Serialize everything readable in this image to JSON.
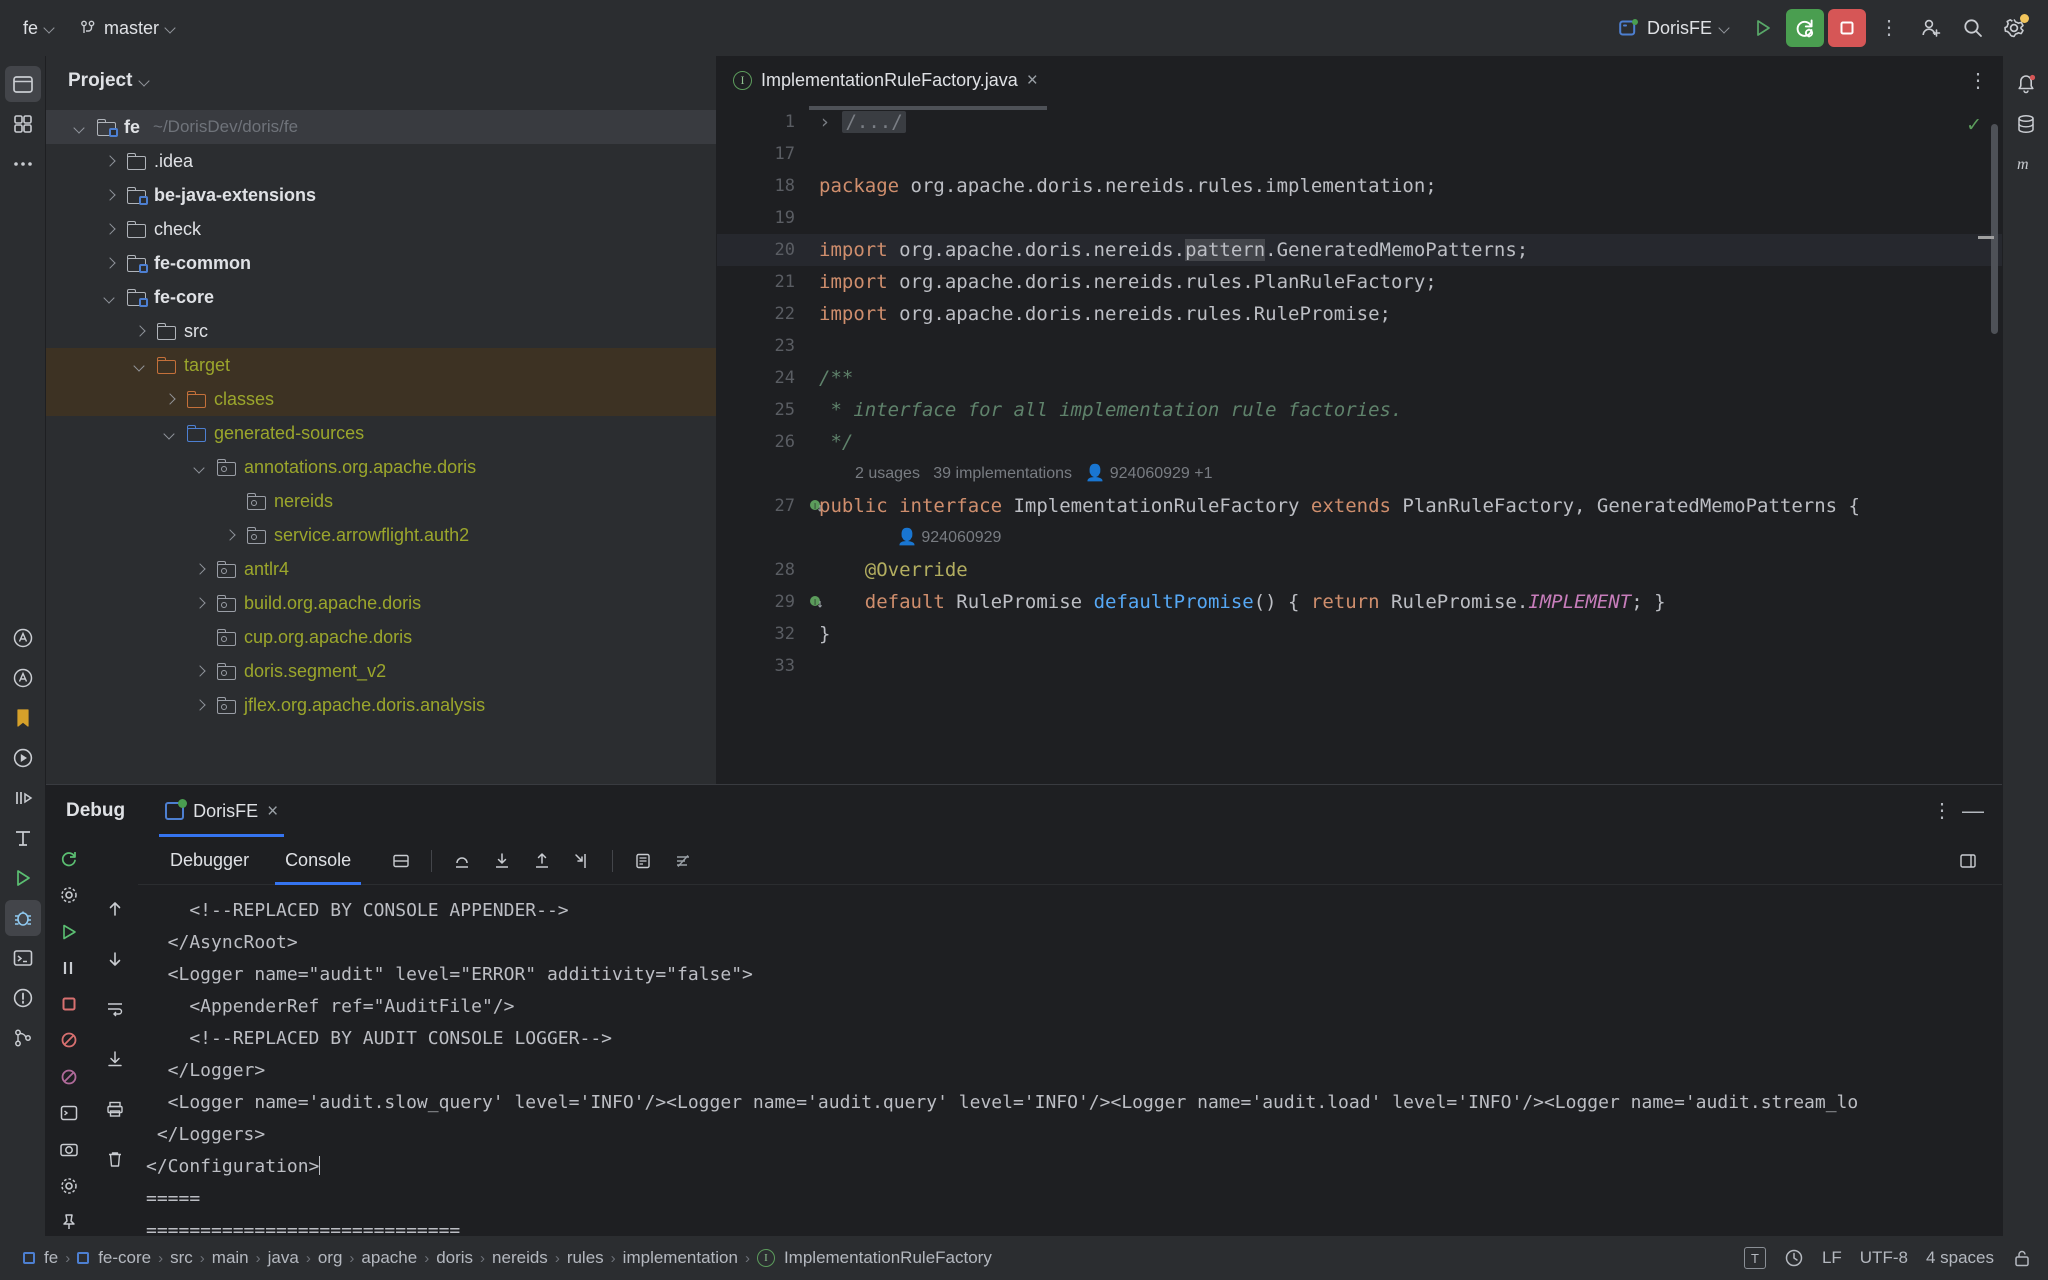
{
  "topbar": {
    "project_name": "fe",
    "branch": "master",
    "branch_icon": "git-branch-icon",
    "run_config": "DorisFE",
    "run_button": "run-icon",
    "rerun_debug_button": "rerun-debug-icon",
    "stop_button": "stop-icon",
    "more_button": "more-vertical-icon",
    "add_user_button": "add-user-icon",
    "search_button": "search-icon",
    "settings_button": "settings-gear-icon",
    "accent_green": "#4a9e50",
    "accent_red": "#d65656",
    "badge_yellow": "#f2c55c"
  },
  "project_panel": {
    "title": "Project",
    "tree": [
      {
        "label": "fe",
        "path": "~/DorisDev/doris/fe",
        "indent": 0,
        "arrow": "open",
        "icon": "module-folder-icon",
        "bold": true,
        "selected": true
      },
      {
        "label": ".idea",
        "path": "",
        "indent": 1,
        "arrow": "closed",
        "icon": "folder-icon",
        "bold": false,
        "selected": false
      },
      {
        "label": "be-java-extensions",
        "path": "",
        "indent": 1,
        "arrow": "closed",
        "icon": "module-folder-icon",
        "bold": true,
        "selected": false
      },
      {
        "label": "check",
        "path": "",
        "indent": 1,
        "arrow": "closed",
        "icon": "folder-icon",
        "bold": false,
        "selected": false
      },
      {
        "label": "fe-common",
        "path": "",
        "indent": 1,
        "arrow": "closed",
        "icon": "module-folder-icon",
        "bold": true,
        "selected": false
      },
      {
        "label": "fe-core",
        "path": "",
        "indent": 1,
        "arrow": "open",
        "icon": "module-folder-icon",
        "bold": true,
        "selected": false
      },
      {
        "label": "src",
        "path": "",
        "indent": 2,
        "arrow": "closed",
        "icon": "folder-icon",
        "bold": false,
        "selected": false
      },
      {
        "label": "target",
        "path": "",
        "indent": 2,
        "arrow": "open",
        "icon": "excluded-folder-icon",
        "bold": false,
        "selected": false,
        "highlight": true,
        "color": "yellow"
      },
      {
        "label": "classes",
        "path": "",
        "indent": 3,
        "arrow": "closed",
        "icon": "excluded-folder-icon",
        "bold": false,
        "selected": false,
        "highlight": true,
        "color": "yellow"
      },
      {
        "label": "generated-sources",
        "path": "",
        "indent": 3,
        "arrow": "open",
        "icon": "source-folder-icon",
        "bold": false,
        "selected": false,
        "color": "yellow"
      },
      {
        "label": "annotations.org.apache.doris",
        "path": "",
        "indent": 4,
        "arrow": "open",
        "icon": "package-folder-icon",
        "bold": false,
        "selected": false,
        "color": "yellow"
      },
      {
        "label": "nereids",
        "path": "",
        "indent": 5,
        "arrow": "none",
        "icon": "package-folder-icon",
        "bold": false,
        "selected": false,
        "color": "yellow"
      },
      {
        "label": "service.arrowflight.auth2",
        "path": "",
        "indent": 5,
        "arrow": "closed",
        "icon": "package-folder-icon",
        "bold": false,
        "selected": false,
        "color": "yellow"
      },
      {
        "label": "antlr4",
        "path": "",
        "indent": 4,
        "arrow": "closed",
        "icon": "package-folder-icon",
        "bold": false,
        "selected": false,
        "color": "yellow"
      },
      {
        "label": "build.org.apache.doris",
        "path": "",
        "indent": 4,
        "arrow": "closed",
        "icon": "package-folder-icon",
        "bold": false,
        "selected": false,
        "color": "yellow"
      },
      {
        "label": "cup.org.apache.doris",
        "path": "",
        "indent": 4,
        "arrow": "none",
        "icon": "package-folder-icon",
        "bold": false,
        "selected": false,
        "color": "yellow"
      },
      {
        "label": "doris.segment_v2",
        "path": "",
        "indent": 4,
        "arrow": "closed",
        "icon": "package-folder-icon",
        "bold": false,
        "selected": false,
        "color": "yellow"
      },
      {
        "label": "jflex.org.apache.doris.analysis",
        "path": "",
        "indent": 4,
        "arrow": "closed",
        "icon": "package-folder-icon",
        "bold": false,
        "selected": false,
        "color": "yellow"
      }
    ]
  },
  "editor": {
    "tab_label": "ImplementationRuleFactory.java",
    "tab_icon": "interface-icon",
    "tab_close": "close-icon",
    "options_icon": "more-vertical-icon",
    "inspection_ok": "✓",
    "lines": [
      {
        "num": "1",
        "fold": true,
        "text": "/.../",
        "kind": "folded"
      },
      {
        "num": "17",
        "text": ""
      },
      {
        "num": "18",
        "text": "package org.apache.doris.nereids.rules.implementation;"
      },
      {
        "num": "19",
        "text": ""
      },
      {
        "num": "20",
        "text": "import org.apache.doris.nereids.pattern.GeneratedMemoPatterns;",
        "highlighted": true
      },
      {
        "num": "21",
        "text": "import org.apache.doris.nereids.rules.PlanRuleFactory;"
      },
      {
        "num": "22",
        "text": "import org.apache.doris.nereids.rules.RulePromise;"
      },
      {
        "num": "23",
        "text": ""
      },
      {
        "num": "24",
        "text": "/**"
      },
      {
        "num": "25",
        "text": " * interface for all implementation rule factories."
      },
      {
        "num": "26",
        "text": " */"
      },
      {
        "num": "27",
        "text": "public interface ImplementationRuleFactory extends PlanRuleFactory, GeneratedMemoPatterns {"
      },
      {
        "num": "28",
        "text": "    @Override"
      },
      {
        "num": "29",
        "text": "    default RulePromise defaultPromise() { return RulePromise.IMPLEMENT; }"
      },
      {
        "num": "32",
        "text": "}"
      },
      {
        "num": "33",
        "text": ""
      }
    ],
    "inlay_hints": [
      {
        "after_line": "26",
        "usages": "2 usages",
        "implementations": "39 implementations",
        "author": "924060929 +1"
      },
      {
        "after_line": "27",
        "author": "924060929"
      }
    ]
  },
  "debug_panel": {
    "title": "Debug",
    "tab_label": "DorisFE",
    "tab_close": "close-icon",
    "options_icon": "more-vertical-icon",
    "minimize_icon": "minimize-icon",
    "sub_tabs": [
      {
        "label": "Debugger",
        "active": false
      },
      {
        "label": "Console",
        "active": true
      }
    ],
    "toolbar_icons": [
      "soft-wrap-icon",
      "step-over-icon",
      "step-into-icon",
      "step-out-icon",
      "run-to-cursor-icon",
      "evaluate-expression-icon",
      "mute-breakpoints-icon"
    ],
    "left_rail_icons": [
      "rerun-icon",
      "settings-icon",
      "resume-icon",
      "pause-icon",
      "stop-icon",
      "mute-breakpoints-icon",
      "view-breakpoints-icon",
      "trash-icon"
    ],
    "console_lines": [
      "    <!--REPLACED BY CONSOLE APPENDER-->",
      "  </AsyncRoot>",
      "  <Logger name=\"audit\" level=\"ERROR\" additivity=\"false\">",
      "    <AppenderRef ref=\"AuditFile\"/>",
      "",
      "    <!--REPLACED BY AUDIT CONSOLE LOGGER-->",
      "  </Logger>",
      "  <Logger name='audit.slow_query' level='INFO'/><Logger name='audit.query' level='INFO'/><Logger name='audit.load' level='INFO'/><Logger name='audit.stream_lo",
      " </Loggers>",
      "</Configuration>",
      "=====",
      "============================="
    ]
  },
  "status_bar": {
    "breadcrumbs": [
      {
        "label": "fe",
        "icon": "module-icon"
      },
      {
        "label": "fe-core",
        "icon": "module-icon"
      },
      {
        "label": "src",
        "icon": ""
      },
      {
        "label": "main",
        "icon": ""
      },
      {
        "label": "java",
        "icon": ""
      },
      {
        "label": "org",
        "icon": ""
      },
      {
        "label": "apache",
        "icon": ""
      },
      {
        "label": "doris",
        "icon": ""
      },
      {
        "label": "nereids",
        "icon": ""
      },
      {
        "label": "rules",
        "icon": ""
      },
      {
        "label": "implementation",
        "icon": ""
      },
      {
        "label": "ImplementationRuleFactory",
        "icon": "interface-icon"
      }
    ],
    "separator": "›",
    "right": {
      "translate_badge": "T",
      "sync_icon": "sync-icon",
      "line_separator": "LF",
      "encoding": "UTF-8",
      "indent": "4 spaces",
      "lock_icon": "unlocked-icon"
    }
  },
  "left_rail": {
    "icons": [
      "project-icon",
      "commit-icon",
      "more-tool-windows-icon",
      "ai-assistant-icon",
      "ai-chat-icon",
      "bookmarks-icon",
      "run-icon",
      "debug-step-icon",
      "structure-icon",
      "run-tool-icon",
      "problems-icon",
      "debug-icon",
      "terminal-icon",
      "services-icon",
      "git-icon"
    ]
  },
  "right_rail": {
    "icons": [
      "notifications-icon",
      "database-icon",
      "maven-icon"
    ]
  }
}
